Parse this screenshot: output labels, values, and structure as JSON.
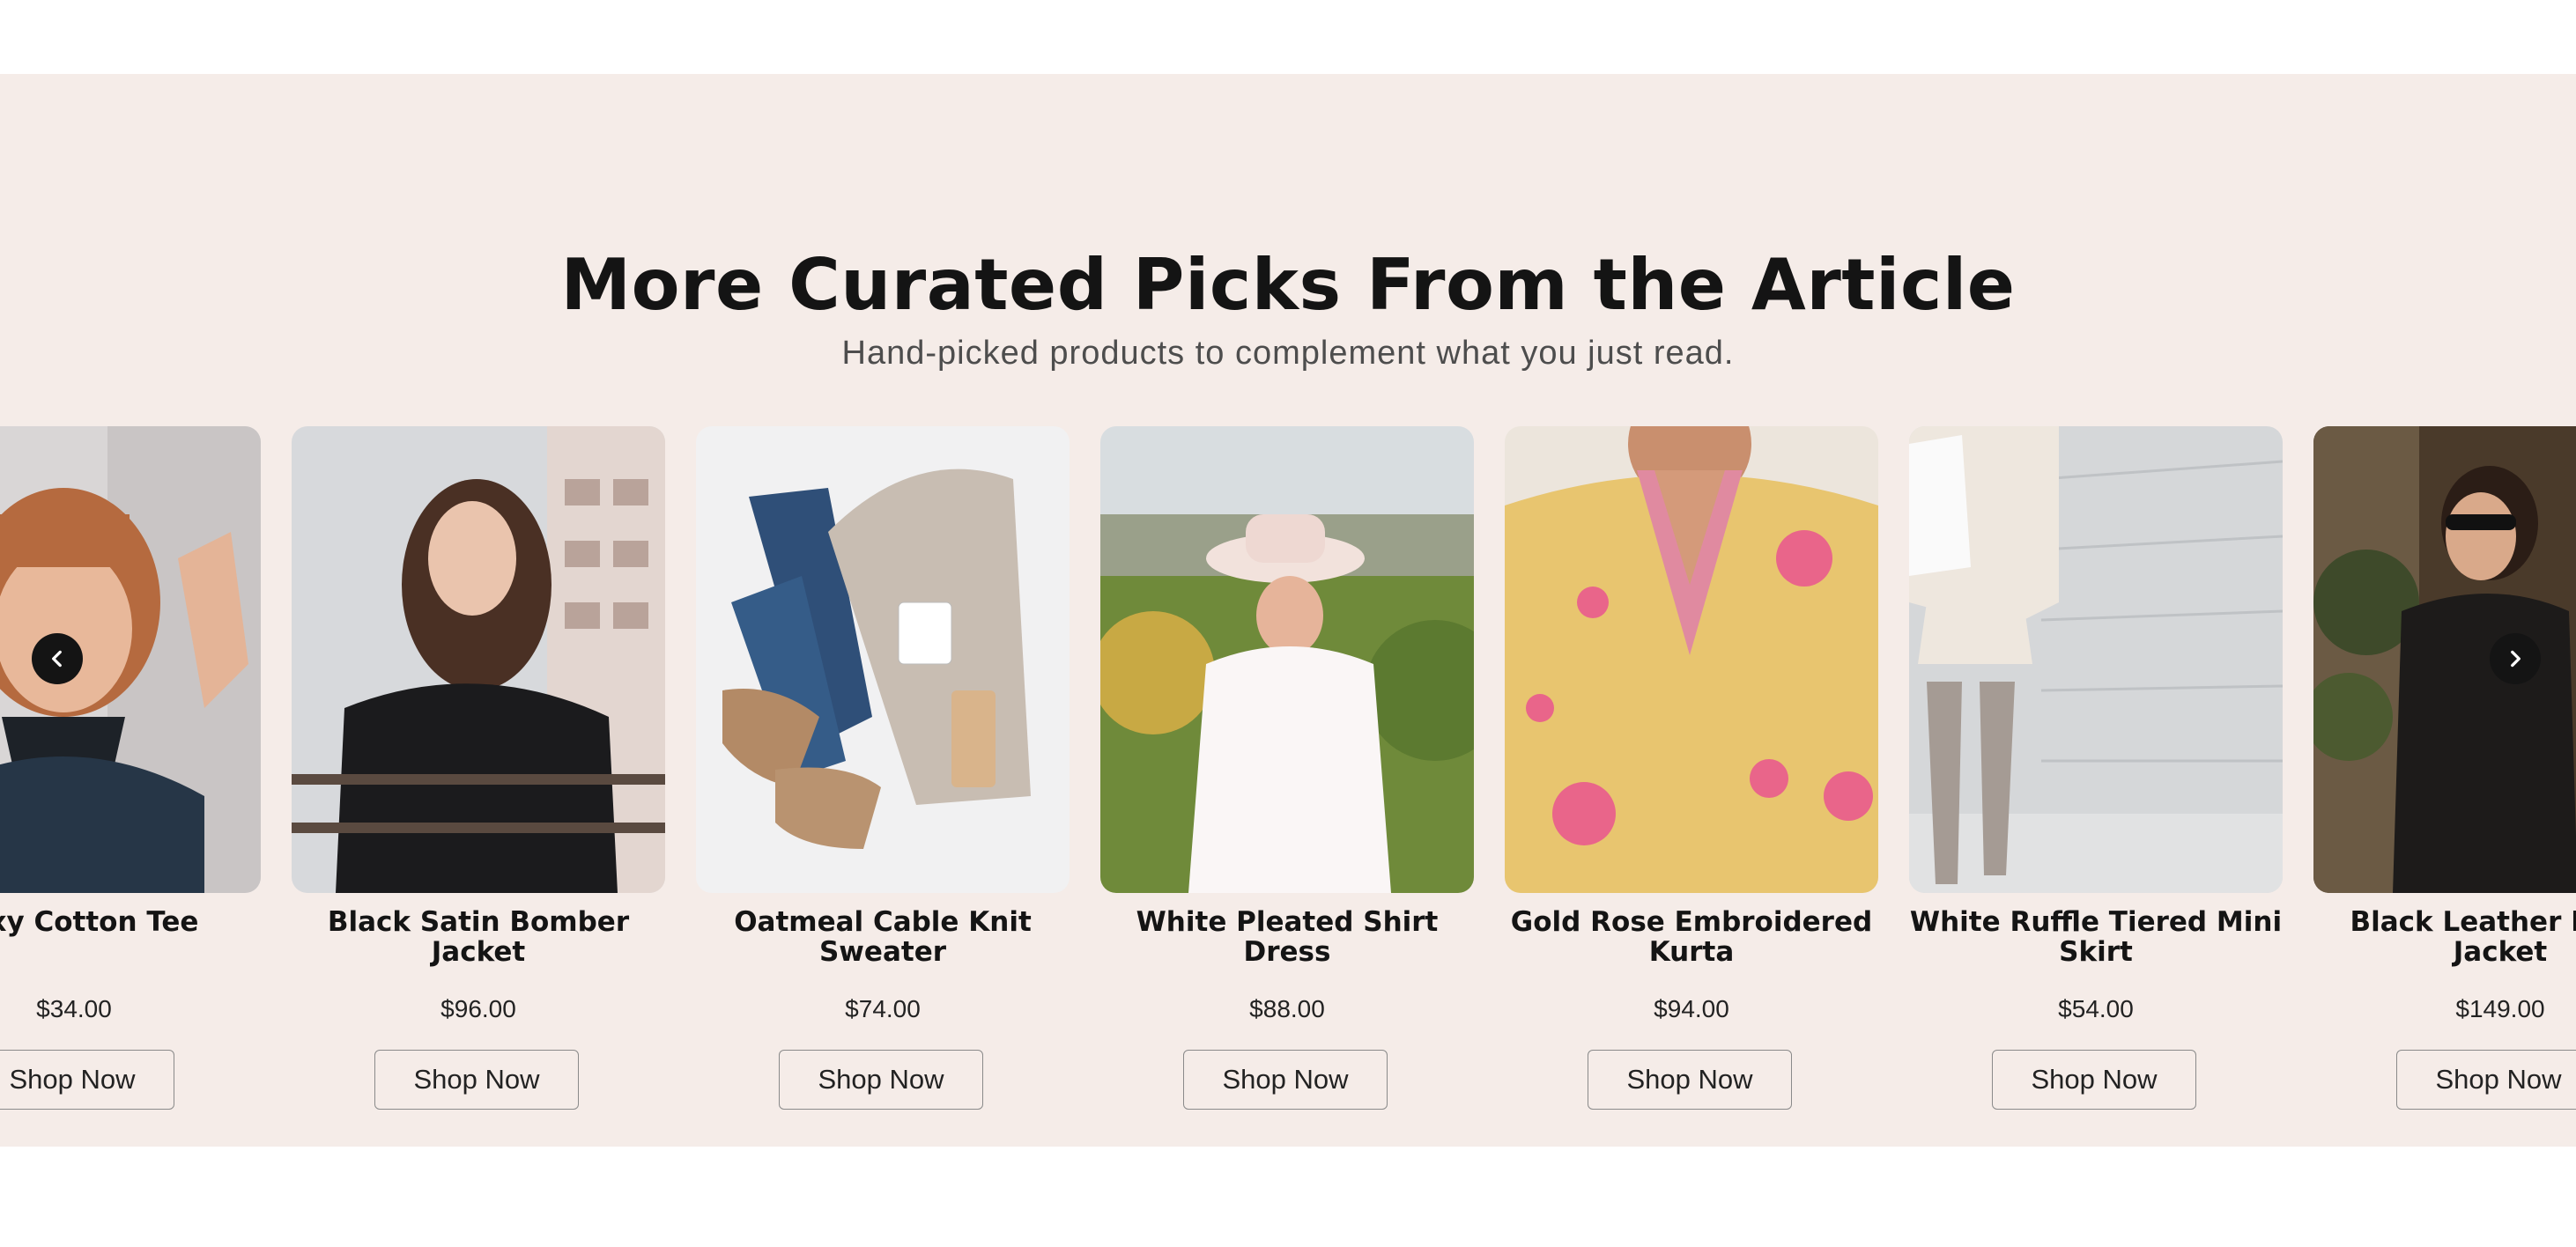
{
  "section": {
    "title": "More Curated Picks From the Article",
    "subtitle": "Hand-picked products to complement what you just read."
  },
  "carousel": {
    "prev_icon": "chevron-left-icon",
    "next_icon": "chevron-right-icon",
    "products": [
      {
        "title": "Boxy Cotton Tee",
        "price": "$34.00",
        "cta": "Shop Now"
      },
      {
        "title": "Black Satin Bomber Jacket",
        "price": "$96.00",
        "cta": "Shop Now"
      },
      {
        "title": "Oatmeal Cable Knit Sweater",
        "price": "$74.00",
        "cta": "Shop Now"
      },
      {
        "title": "White Pleated Shirt Dress",
        "price": "$88.00",
        "cta": "Shop Now"
      },
      {
        "title": "Gold Rose Embroidered Kurta",
        "price": "$94.00",
        "cta": "Shop Now"
      },
      {
        "title": "White Ruffle Tiered Mini Skirt",
        "price": "$54.00",
        "cta": "Shop Now"
      },
      {
        "title": "Black Leather Biker Jacket",
        "price": "$149.00",
        "cta": "Shop Now"
      }
    ]
  },
  "colors": {
    "section_bg": "#f5ece8",
    "heading": "#141414",
    "arrow_bg": "#141414"
  }
}
